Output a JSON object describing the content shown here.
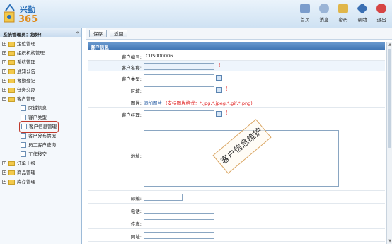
{
  "app": {
    "logo_text_top": "兴勤",
    "logo_text_bottom": "365"
  },
  "nav": [
    {
      "label": "首页",
      "icon": "home-icon",
      "color": "#7a9ccc"
    },
    {
      "label": "消息",
      "icon": "message-icon",
      "color": "#9ab4d6"
    },
    {
      "label": "密码",
      "icon": "lock-icon",
      "color": "#e0b64a"
    },
    {
      "label": "帮助",
      "icon": "help-icon",
      "color": "#3a6fb3"
    },
    {
      "label": "退出",
      "icon": "exit-icon",
      "color": "#d64545"
    }
  ],
  "sidebar": {
    "user_greeting": "系统管理员：您好！",
    "collapse_glyph": "«",
    "tree": [
      {
        "label": "定位管理",
        "expanded": false
      },
      {
        "label": "组织机构管理",
        "expanded": false
      },
      {
        "label": "系统管理",
        "expanded": false
      },
      {
        "label": "通知公告",
        "expanded": false
      },
      {
        "label": "考勤登记",
        "expanded": false
      },
      {
        "label": "任务交办",
        "expanded": false
      },
      {
        "label": "客户管理",
        "expanded": true,
        "children": [
          "区域信息",
          "客户类型",
          "客户信息管理",
          "客户分布情况",
          "员工客户查询",
          "工作移交"
        ]
      },
      {
        "label": "订单上报",
        "expanded": false
      },
      {
        "label": "商品管理",
        "expanded": false
      },
      {
        "label": "库存管理",
        "expanded": false
      }
    ],
    "selected_child": "客户信息管理"
  },
  "toolbar": {
    "save_label": "保存",
    "back_label": "返回"
  },
  "form": {
    "title": "客户信息",
    "fields": {
      "code_label": "客户编号:",
      "code_value": "CUS000006",
      "name_label": "客户名称:",
      "type_label": "客户类型:",
      "region_label": "区域:",
      "image_label": "图片:",
      "image_add": "添加图片",
      "image_hint": "(支持图片格式：*.jpg,*.jpeg,*.gif,*.png)",
      "manager_label": "客户经理:",
      "address_label": "地址:",
      "zip_label": "邮编:",
      "phone_label": "电话:",
      "fax_label": "传真:",
      "website_label": "网址:"
    },
    "required_mark": "!",
    "stamp_text": "客户信息维护"
  },
  "colors": {
    "accent": "#3f74b3",
    "required": "#e02020",
    "highlight_outline": "#c0392b"
  }
}
